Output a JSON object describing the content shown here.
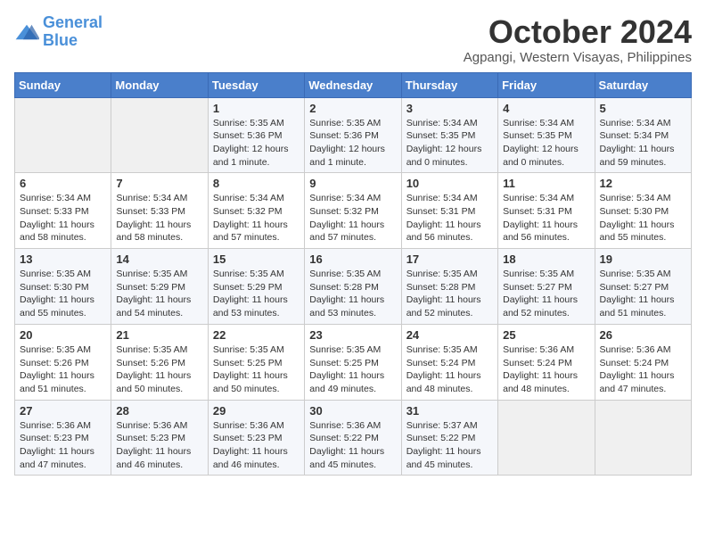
{
  "logo": {
    "line1": "General",
    "line2": "Blue"
  },
  "title": "October 2024",
  "subtitle": "Agpangi, Western Visayas, Philippines",
  "weekdays": [
    "Sunday",
    "Monday",
    "Tuesday",
    "Wednesday",
    "Thursday",
    "Friday",
    "Saturday"
  ],
  "weeks": [
    [
      {
        "day": "",
        "info": ""
      },
      {
        "day": "",
        "info": ""
      },
      {
        "day": "1",
        "info": "Sunrise: 5:35 AM\nSunset: 5:36 PM\nDaylight: 12 hours\nand 1 minute."
      },
      {
        "day": "2",
        "info": "Sunrise: 5:35 AM\nSunset: 5:36 PM\nDaylight: 12 hours\nand 1 minute."
      },
      {
        "day": "3",
        "info": "Sunrise: 5:34 AM\nSunset: 5:35 PM\nDaylight: 12 hours\nand 0 minutes."
      },
      {
        "day": "4",
        "info": "Sunrise: 5:34 AM\nSunset: 5:35 PM\nDaylight: 12 hours\nand 0 minutes."
      },
      {
        "day": "5",
        "info": "Sunrise: 5:34 AM\nSunset: 5:34 PM\nDaylight: 11 hours\nand 59 minutes."
      }
    ],
    [
      {
        "day": "6",
        "info": "Sunrise: 5:34 AM\nSunset: 5:33 PM\nDaylight: 11 hours\nand 58 minutes."
      },
      {
        "day": "7",
        "info": "Sunrise: 5:34 AM\nSunset: 5:33 PM\nDaylight: 11 hours\nand 58 minutes."
      },
      {
        "day": "8",
        "info": "Sunrise: 5:34 AM\nSunset: 5:32 PM\nDaylight: 11 hours\nand 57 minutes."
      },
      {
        "day": "9",
        "info": "Sunrise: 5:34 AM\nSunset: 5:32 PM\nDaylight: 11 hours\nand 57 minutes."
      },
      {
        "day": "10",
        "info": "Sunrise: 5:34 AM\nSunset: 5:31 PM\nDaylight: 11 hours\nand 56 minutes."
      },
      {
        "day": "11",
        "info": "Sunrise: 5:34 AM\nSunset: 5:31 PM\nDaylight: 11 hours\nand 56 minutes."
      },
      {
        "day": "12",
        "info": "Sunrise: 5:34 AM\nSunset: 5:30 PM\nDaylight: 11 hours\nand 55 minutes."
      }
    ],
    [
      {
        "day": "13",
        "info": "Sunrise: 5:35 AM\nSunset: 5:30 PM\nDaylight: 11 hours\nand 55 minutes."
      },
      {
        "day": "14",
        "info": "Sunrise: 5:35 AM\nSunset: 5:29 PM\nDaylight: 11 hours\nand 54 minutes."
      },
      {
        "day": "15",
        "info": "Sunrise: 5:35 AM\nSunset: 5:29 PM\nDaylight: 11 hours\nand 53 minutes."
      },
      {
        "day": "16",
        "info": "Sunrise: 5:35 AM\nSunset: 5:28 PM\nDaylight: 11 hours\nand 53 minutes."
      },
      {
        "day": "17",
        "info": "Sunrise: 5:35 AM\nSunset: 5:28 PM\nDaylight: 11 hours\nand 52 minutes."
      },
      {
        "day": "18",
        "info": "Sunrise: 5:35 AM\nSunset: 5:27 PM\nDaylight: 11 hours\nand 52 minutes."
      },
      {
        "day": "19",
        "info": "Sunrise: 5:35 AM\nSunset: 5:27 PM\nDaylight: 11 hours\nand 51 minutes."
      }
    ],
    [
      {
        "day": "20",
        "info": "Sunrise: 5:35 AM\nSunset: 5:26 PM\nDaylight: 11 hours\nand 51 minutes."
      },
      {
        "day": "21",
        "info": "Sunrise: 5:35 AM\nSunset: 5:26 PM\nDaylight: 11 hours\nand 50 minutes."
      },
      {
        "day": "22",
        "info": "Sunrise: 5:35 AM\nSunset: 5:25 PM\nDaylight: 11 hours\nand 50 minutes."
      },
      {
        "day": "23",
        "info": "Sunrise: 5:35 AM\nSunset: 5:25 PM\nDaylight: 11 hours\nand 49 minutes."
      },
      {
        "day": "24",
        "info": "Sunrise: 5:35 AM\nSunset: 5:24 PM\nDaylight: 11 hours\nand 48 minutes."
      },
      {
        "day": "25",
        "info": "Sunrise: 5:36 AM\nSunset: 5:24 PM\nDaylight: 11 hours\nand 48 minutes."
      },
      {
        "day": "26",
        "info": "Sunrise: 5:36 AM\nSunset: 5:24 PM\nDaylight: 11 hours\nand 47 minutes."
      }
    ],
    [
      {
        "day": "27",
        "info": "Sunrise: 5:36 AM\nSunset: 5:23 PM\nDaylight: 11 hours\nand 47 minutes."
      },
      {
        "day": "28",
        "info": "Sunrise: 5:36 AM\nSunset: 5:23 PM\nDaylight: 11 hours\nand 46 minutes."
      },
      {
        "day": "29",
        "info": "Sunrise: 5:36 AM\nSunset: 5:23 PM\nDaylight: 11 hours\nand 46 minutes."
      },
      {
        "day": "30",
        "info": "Sunrise: 5:36 AM\nSunset: 5:22 PM\nDaylight: 11 hours\nand 45 minutes."
      },
      {
        "day": "31",
        "info": "Sunrise: 5:37 AM\nSunset: 5:22 PM\nDaylight: 11 hours\nand 45 minutes."
      },
      {
        "day": "",
        "info": ""
      },
      {
        "day": "",
        "info": ""
      }
    ]
  ]
}
